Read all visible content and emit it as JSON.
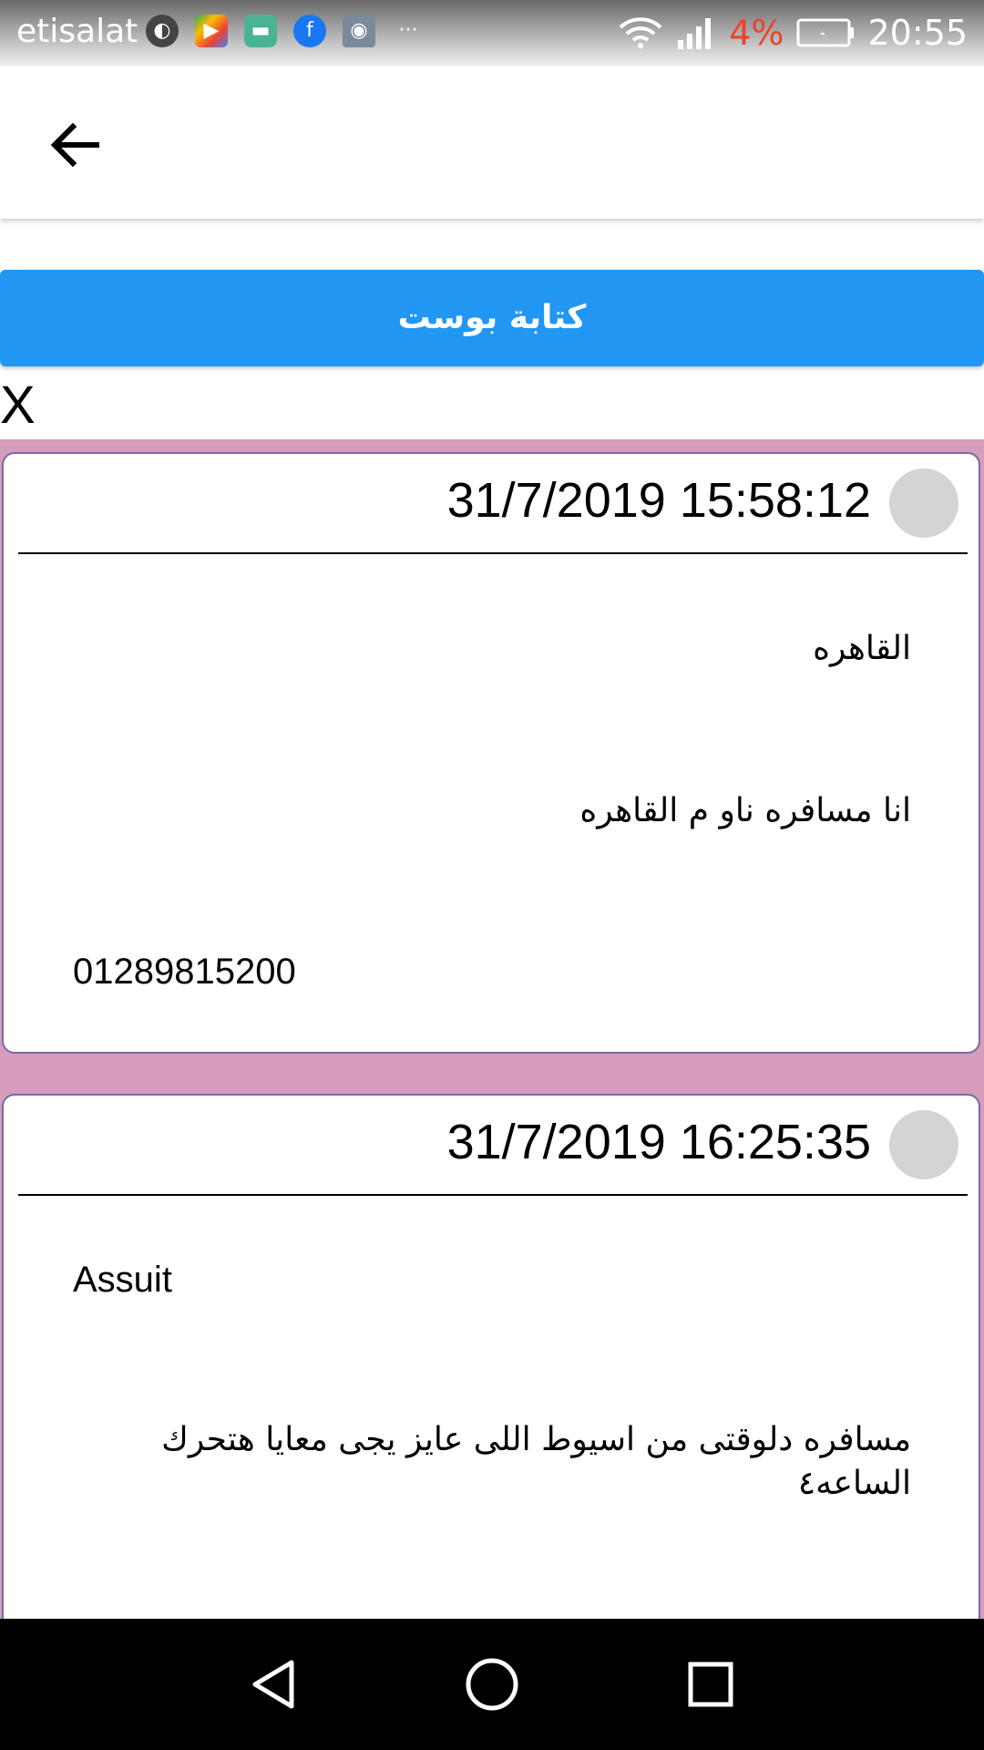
{
  "status_bar": {
    "carrier": "etisalat",
    "more": "···",
    "battery_percent": "4%",
    "time": "20:55",
    "notification_icons": [
      "profile-icon",
      "play-games-icon",
      "messages-icon",
      "facebook-icon",
      "mail-eye-icon"
    ]
  },
  "toolbar": {
    "write_post_label": "كتابة بوست",
    "close_label": "X"
  },
  "posts": [
    {
      "date": "31/7/2019 15:58:12",
      "city": "القاهره",
      "message": "انا مسافره ناو م القاهره",
      "phone": "01289815200"
    },
    {
      "date": "31/7/2019 16:25:35",
      "city": "Assuit",
      "message_line1": "مسافره دلوقتى من اسيوط اللى عايز يجى معايا هتحرك",
      "message_line2": "الساعه٤"
    }
  ],
  "colors": {
    "accent": "#2196f3",
    "feed_background": "#d59dbb",
    "card_border": "#7a68a8",
    "battery_low": "#e8452c"
  }
}
